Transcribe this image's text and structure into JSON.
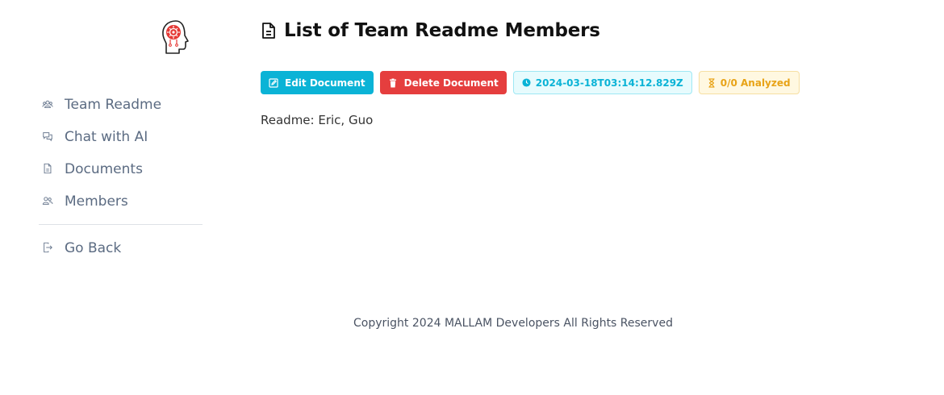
{
  "sidebar": {
    "logo_icon": "brain-head-icon",
    "items": [
      {
        "label": "Team Readme",
        "icon": "team-icon"
      },
      {
        "label": "Chat with AI",
        "icon": "chat-icon"
      },
      {
        "label": "Documents",
        "icon": "document-icon"
      },
      {
        "label": "Members",
        "icon": "members-icon"
      }
    ],
    "go_back": {
      "label": "Go Back",
      "icon": "exit-icon"
    }
  },
  "main": {
    "title": "List of Team Readme Members",
    "title_icon": "file-text-icon",
    "actions": {
      "edit_label": "Edit Document",
      "delete_label": "Delete Document",
      "date_badge": "2024-03-18T03:14:12.829Z",
      "analyzed_badge": "0/0 Analyzed"
    },
    "readme_text": "Readme: Eric, Guo"
  },
  "footer": {
    "copyright": "Copyright 2024 MALLAM Developers All Rights Reserved"
  },
  "colors": {
    "accent": "#0bb3d6",
    "danger": "#e53e3e",
    "warning": "#e8a317",
    "logo_red": "#e53935"
  }
}
